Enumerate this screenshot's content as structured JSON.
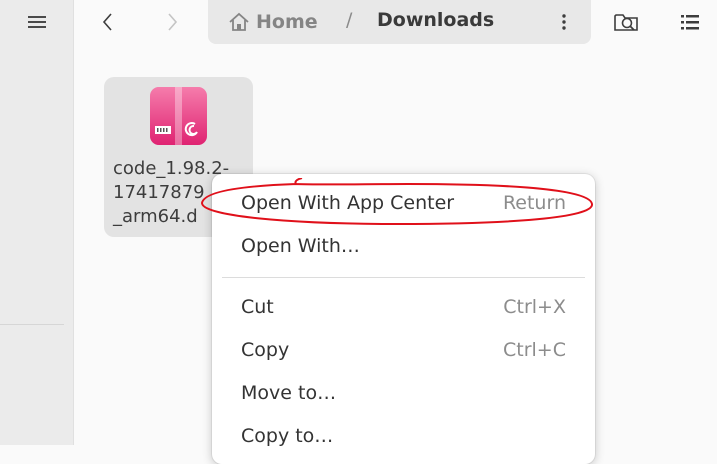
{
  "sidebar": {
    "menu_icon": "hamburger-menu-icon"
  },
  "header": {
    "back_icon": "chevron-left-icon",
    "forward_icon": "chevron-right-icon",
    "path": {
      "home_icon": "home-icon",
      "home_label": "Home",
      "separator": "/",
      "current": "Downloads",
      "menu_icon": "vertical-ellipsis-icon"
    },
    "search_icon": "search-folder-icon",
    "view_icon": "list-view-icon"
  },
  "files": [
    {
      "name": "code_1.98.2-\n17417879\n_arm64.d",
      "icon": "debian-package-icon"
    }
  ],
  "context_menu": {
    "items": [
      {
        "label": "Open With App Center",
        "accel": "Return"
      },
      {
        "label": "Open With…",
        "accel": ""
      },
      {
        "label": "Cut",
        "accel": "Ctrl+X"
      },
      {
        "label": "Copy",
        "accel": "Ctrl+C"
      },
      {
        "label": "Move to…",
        "accel": ""
      },
      {
        "label": "Copy to…",
        "accel": ""
      }
    ]
  },
  "colors": {
    "package_icon": "#f0367f",
    "annotation": "#e0101a"
  }
}
